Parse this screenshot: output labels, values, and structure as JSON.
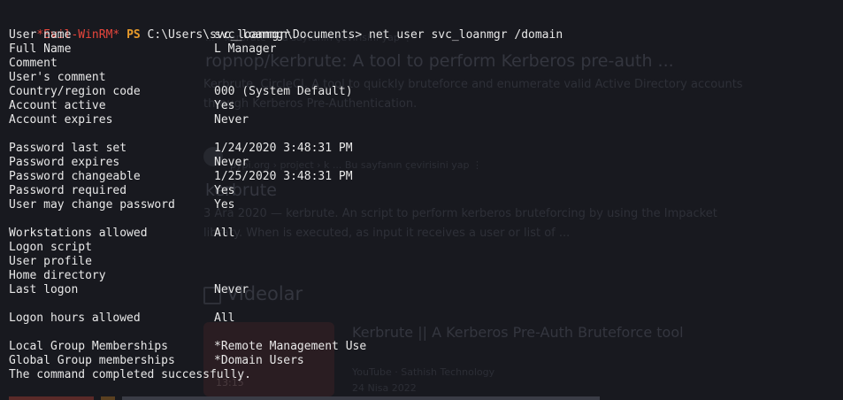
{
  "prompt": {
    "marker": "*Evil-WinRM*",
    "shell": "PS",
    "path": "C:\\Users\\svc_loanmgr\\Documents>",
    "command": "net user svc_loanmgr /domain"
  },
  "rows": [
    {
      "label": "User name",
      "value": "svc_loanmgr"
    },
    {
      "label": "Full Name",
      "value": "L Manager"
    },
    {
      "label": "Comment",
      "value": ""
    },
    {
      "label": "User's comment",
      "value": ""
    },
    {
      "label": "Country/region code",
      "value": "000 (System Default)"
    },
    {
      "label": "Account active",
      "value": "Yes"
    },
    {
      "label": "Account expires",
      "value": "Never"
    },
    {
      "label": "Password last set",
      "value": "1/24/2020 3:48:31 PM"
    },
    {
      "label": "Password expires",
      "value": "Never"
    },
    {
      "label": "Password changeable",
      "value": "1/25/2020 3:48:31 PM"
    },
    {
      "label": "Password required",
      "value": "Yes"
    },
    {
      "label": "User may change password",
      "value": "Yes"
    },
    {
      "label": "Workstations allowed",
      "value": "All"
    },
    {
      "label": "Logon script",
      "value": ""
    },
    {
      "label": "User profile",
      "value": ""
    },
    {
      "label": "Home directory",
      "value": ""
    },
    {
      "label": "Last logon",
      "value": "Never"
    },
    {
      "label": "Logon hours allowed",
      "value": "All"
    },
    {
      "label": "Local Group Memberships",
      "value": "*Remote Management Use"
    },
    {
      "label": "Global Group memberships",
      "value": "*Domain Users"
    }
  ],
  "completion": "The command completed successfully.",
  "background_page": {
    "crumb": "... › kerbrute · Bu sayfanın çevirisini yap ⋮",
    "result1_title": "ropnop/kerbrute: A tool to perform Kerberos pre-auth ...",
    "result1_snippet1": "Kerbrute. CircleCI. A tool to quickly bruteforce and enumerate valid Active Directory accounts",
    "result1_snippet2": "through Kerberos Pre-Authentication.",
    "result2_source": "pypi.org › project › k ...   Bu sayfanın çevirisini yap   ⋮",
    "result2_title": "kerbrute",
    "result2_snippet1": "3 Ara 2020 — kerbrute. An script to perform kerberos bruteforcing by using the Impacket",
    "result2_snippet2": "library. When is executed, as input it receives a user or list of ...",
    "videos_heading": "Videolar",
    "video_title": "Kerbrute || A Kerberos Pre-Auth Bruteforce tool",
    "video_channel": "YouTube · Sathish Technology",
    "video_date": "24 Nisa 2022",
    "video_duration": "13:15"
  },
  "colors": {
    "background": "#18191f",
    "text": "#e8e8e8",
    "prompt_marker": "#e8463c",
    "prompt_ps": "#e89b2b"
  }
}
